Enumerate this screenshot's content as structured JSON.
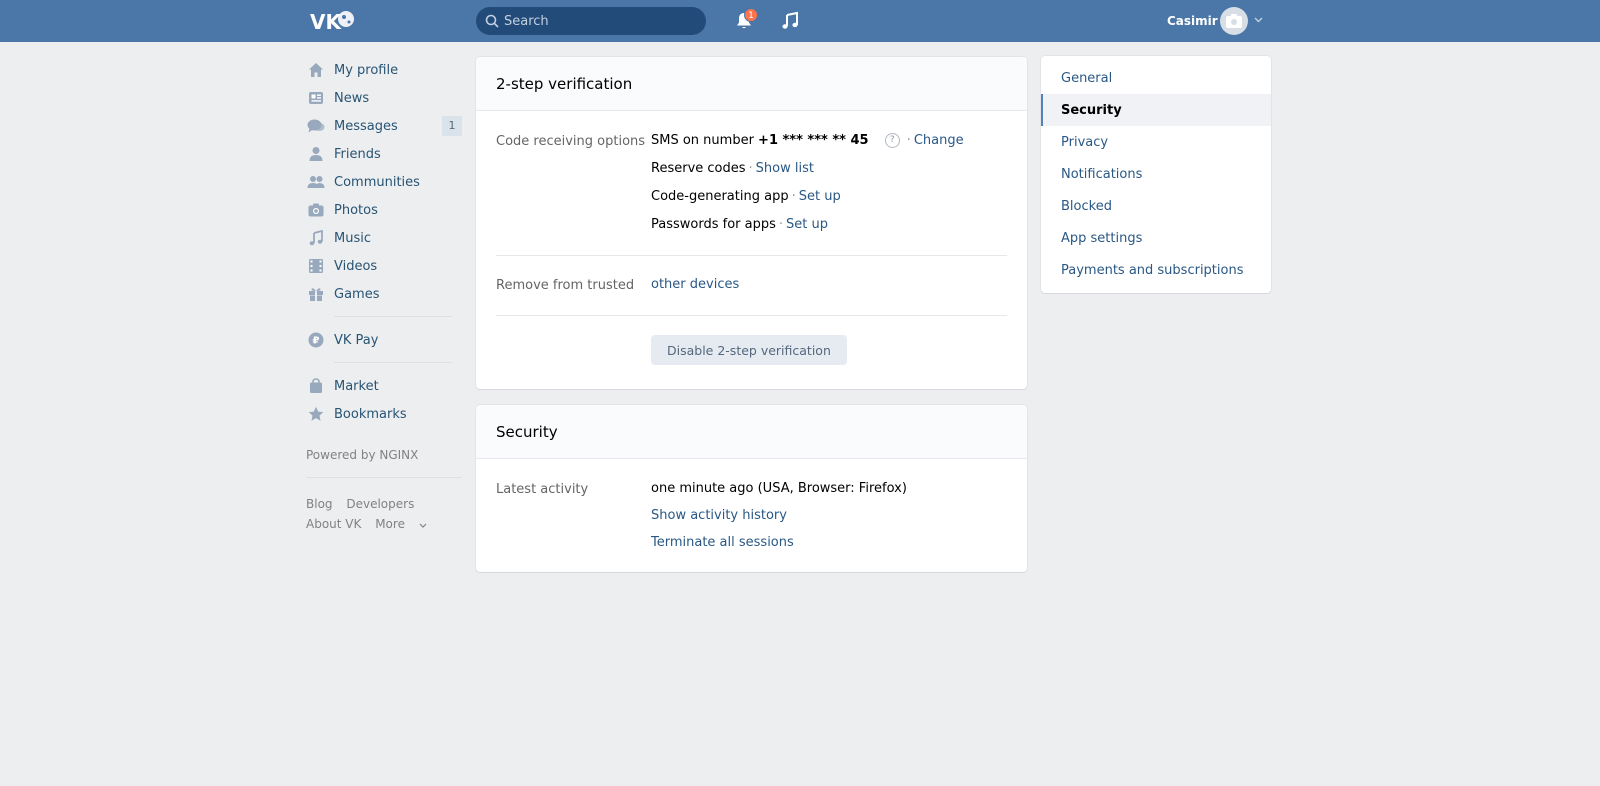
{
  "header": {
    "search_placeholder": "Search",
    "notifications_count": "1",
    "user_name": "Casimir"
  },
  "leftnav": {
    "items": [
      {
        "label": "My profile",
        "icon": "home-icon"
      },
      {
        "label": "News",
        "icon": "news-icon"
      },
      {
        "label": "Messages",
        "icon": "messages-icon",
        "count": "1"
      },
      {
        "label": "Friends",
        "icon": "friends-icon"
      },
      {
        "label": "Communities",
        "icon": "communities-icon"
      },
      {
        "label": "Photos",
        "icon": "camera-icon"
      },
      {
        "label": "Music",
        "icon": "music-icon"
      },
      {
        "label": "Videos",
        "icon": "film-icon"
      },
      {
        "label": "Games",
        "icon": "gift-icon"
      }
    ],
    "vkpay": "VK Pay",
    "market": "Market",
    "bookmarks": "Bookmarks",
    "powered": "Powered by NGINX",
    "footer": {
      "blog": "Blog",
      "developers": "Developers",
      "about": "About VK",
      "more": "More"
    }
  },
  "twostep": {
    "title": "2-step verification",
    "code_label": "Code receiving options",
    "sms_prefix": "SMS on number ",
    "sms_number": "+1 *** *** ** 45",
    "help": "?",
    "change": "Change",
    "reserve_codes": "Reserve codes",
    "show_list": "Show list",
    "code_app": "Code-generating app",
    "set_up_app": "Set up",
    "passwords_apps": "Passwords for apps",
    "set_up_pw": "Set up",
    "remove_label": "Remove from trusted",
    "other_devices": "other devices",
    "disable_button": "Disable 2-step verification",
    "separator": "·"
  },
  "security": {
    "title": "Security",
    "activity_label": "Latest activity",
    "activity_value": "one minute ago (USA, Browser: Firefox)",
    "show_history": "Show activity history",
    "terminate": "Terminate all sessions"
  },
  "settings_menu": {
    "items": [
      {
        "label": "General"
      },
      {
        "label": "Security",
        "active": true
      },
      {
        "label": "Privacy"
      },
      {
        "label": "Notifications"
      },
      {
        "label": "Blocked"
      },
      {
        "label": "App settings"
      },
      {
        "label": "Payments and subscriptions"
      }
    ]
  },
  "colors": {
    "header": "#4a76a8",
    "link": "#2a5885",
    "badge": "#ff734c",
    "background": "#edeef0"
  }
}
